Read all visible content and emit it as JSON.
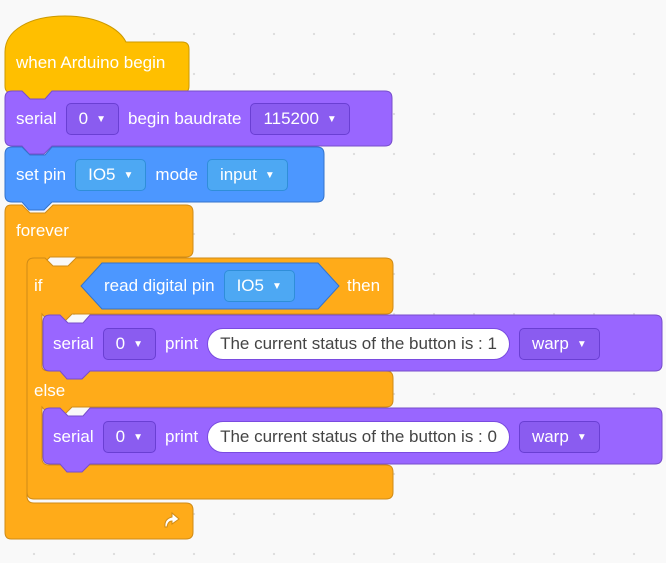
{
  "colors": {
    "event": "#ffbf00",
    "control": "#ffab19",
    "serial": "#9966ff",
    "pin": "#4c97ff",
    "canvas": "#f9f9f9"
  },
  "blocks": {
    "hat": {
      "label": "when Arduino begin"
    },
    "serial_begin": {
      "label": "serial",
      "port": "0",
      "action": "begin baudrate",
      "baud": "115200"
    },
    "set_pin": {
      "label": "set pin",
      "pin": "IO5",
      "mode_label": "mode",
      "mode": "input"
    },
    "forever": {
      "label": "forever"
    },
    "if_else": {
      "if_label": "if",
      "then_label": "then",
      "else_label": "else"
    },
    "read_pin": {
      "label": "read digital pin",
      "pin": "IO5"
    },
    "print1": {
      "label": "serial",
      "port": "0",
      "print_label": "print",
      "text": "The current status of the button is : 1",
      "mode": "warp"
    },
    "print2": {
      "label": "serial",
      "port": "0",
      "print_label": "print",
      "text": "The current status of the button is : 0",
      "mode": "warp"
    }
  },
  "icons": {
    "loop": "loop-arrow-icon",
    "dropdown": "chevron-down-icon"
  }
}
